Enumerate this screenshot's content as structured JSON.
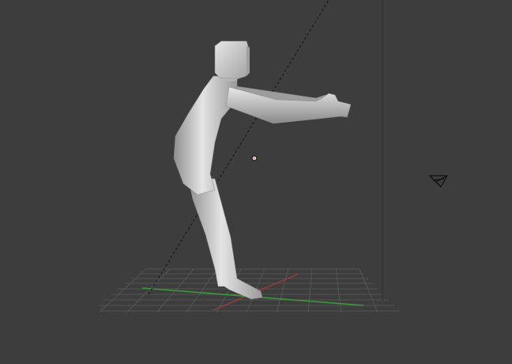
{
  "viewport": {
    "background_color": "#3d3d3d",
    "grid_color": "#5a5a5a",
    "x_axis_color": "#b03a3a",
    "y_axis_color": "#3d9a3d",
    "model_color": "#c8c8c8",
    "light_indicator_color": "#e6b4b4"
  },
  "scene_objects": [
    {
      "name": "humanoid-mesh",
      "icon": "mesh"
    },
    {
      "name": "lamp",
      "icon": "light-icon"
    },
    {
      "name": "camera",
      "icon": "camera-icon"
    }
  ]
}
